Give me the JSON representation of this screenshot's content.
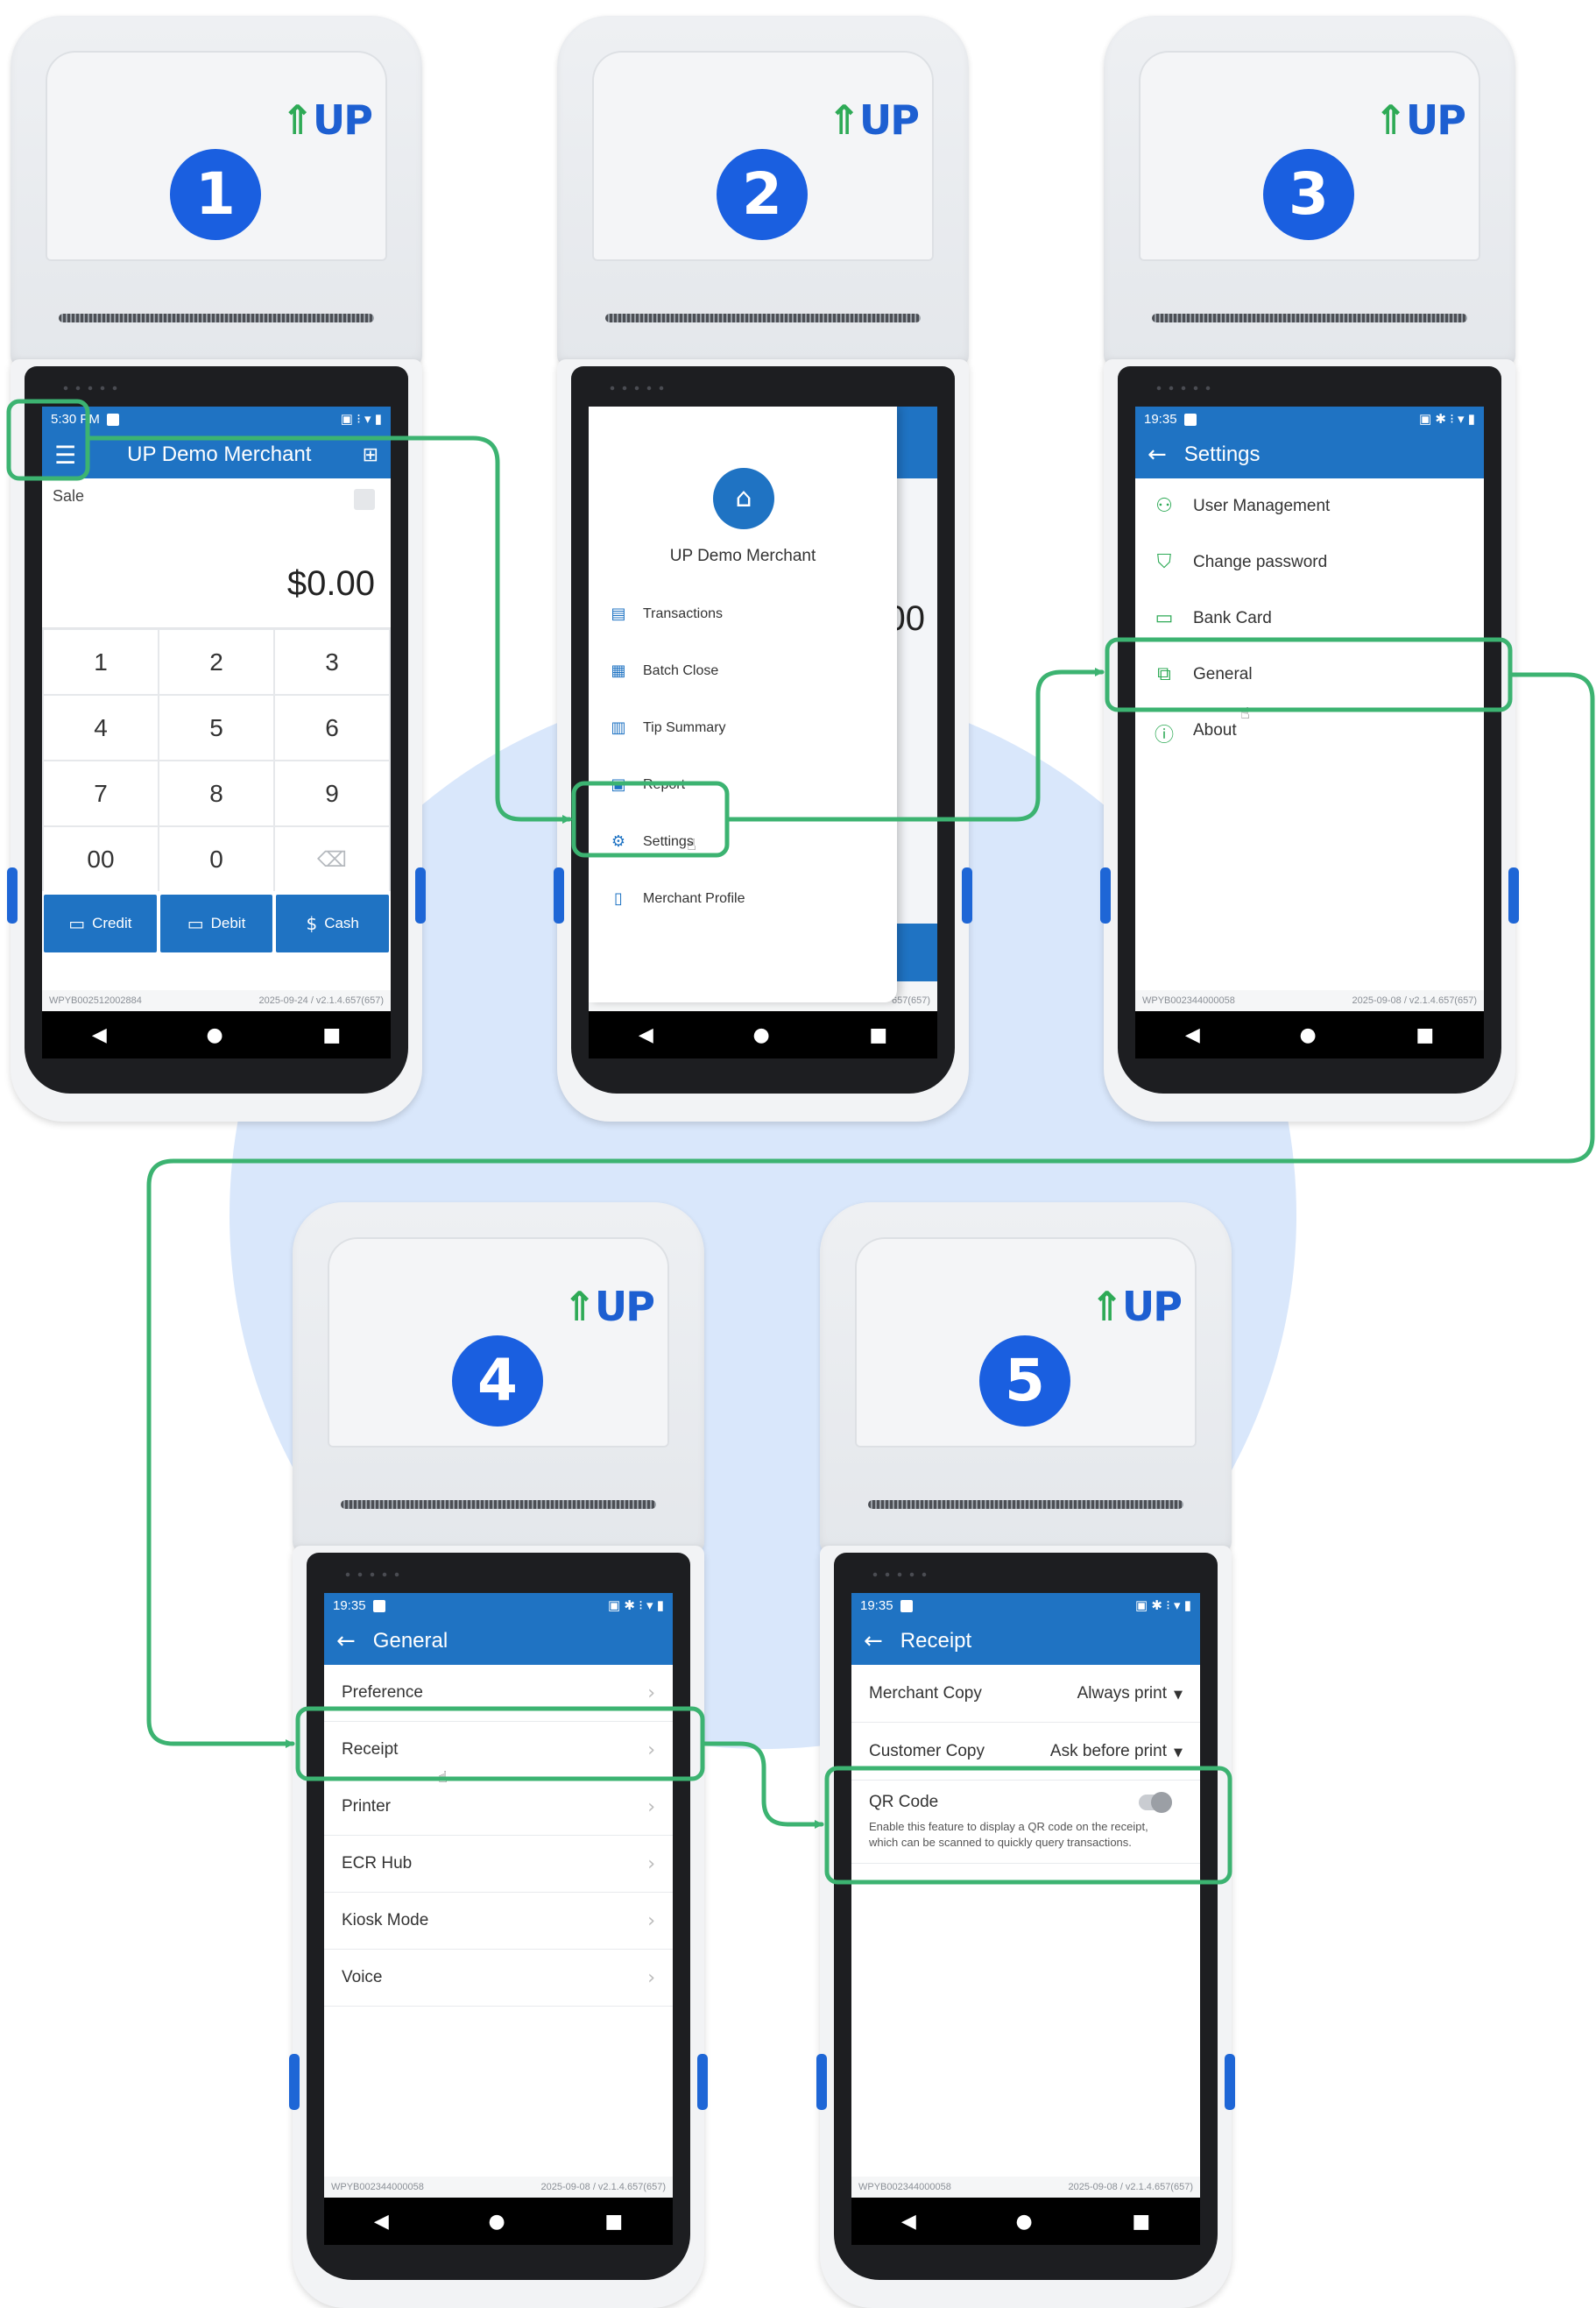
{
  "steps": [
    "1",
    "2",
    "3",
    "4",
    "5"
  ],
  "brand_logo": "UP",
  "nav": {
    "back": "◀",
    "home": "●",
    "recent": "■"
  },
  "screen1": {
    "status_time": "5:30 PM",
    "title": "UP Demo Merchant",
    "sale_label": "Sale",
    "amount": "$0.00",
    "keys": [
      "1",
      "2",
      "3",
      "4",
      "5",
      "6",
      "7",
      "8",
      "9",
      "00",
      "0",
      "⌫"
    ],
    "credit": "Credit",
    "debit": "Debit",
    "cash": "Cash",
    "serial": "WPYB002512002884",
    "version": "2025-09-24 / v2.1.4.657(657)"
  },
  "screen2": {
    "merchant": "UP Demo Merchant",
    "under_amount": "00",
    "menu": [
      "Transactions",
      "Batch Close",
      "Tip Summary",
      "Report",
      "Settings",
      "Merchant Profile"
    ],
    "version_tail": "657(657)"
  },
  "screen3": {
    "status_time": "19:35",
    "title": "Settings",
    "items": [
      "User Management",
      "Change password",
      "Bank Card",
      "General",
      "About"
    ],
    "serial": "WPYB002344000058",
    "version": "2025-09-08 / v2.1.4.657(657)"
  },
  "screen4": {
    "status_time": "19:35",
    "title": "General",
    "items": [
      "Preference",
      "Receipt",
      "Printer",
      "ECR Hub",
      "Kiosk Mode",
      "Voice"
    ],
    "serial": "WPYB002344000058",
    "version": "2025-09-08 / v2.1.4.657(657)"
  },
  "screen5": {
    "status_time": "19:35",
    "title": "Receipt",
    "merchant_copy_label": "Merchant Copy",
    "merchant_copy_value": "Always print",
    "customer_copy_label": "Customer Copy",
    "customer_copy_value": "Ask before print",
    "qr_title": "QR Code",
    "qr_desc": "Enable this feature to display a QR code on the receipt, which can be scanned to quickly query transactions.",
    "qr_enabled": false,
    "serial": "WPYB002344000058",
    "version": "2025-09-08 / v2.1.4.657(657)"
  },
  "colors": {
    "app_blue": "#1f73c3",
    "badge_blue": "#1a5fe0",
    "highlight_green": "#3cb371",
    "background_circle": "#d9e7fb"
  }
}
